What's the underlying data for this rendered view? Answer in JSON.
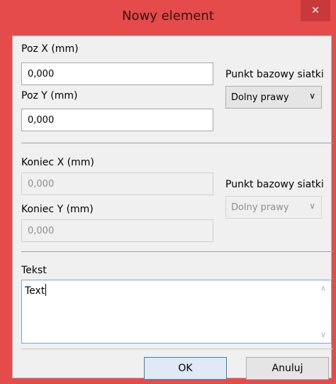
{
  "window": {
    "title": "Nowy element",
    "close_glyph": "✕",
    "close_icon": "close-icon"
  },
  "start": {
    "pos_x_label": "Poz X (mm)",
    "pos_x_value": "0,000",
    "pos_y_label": "Poz Y (mm)",
    "pos_y_value": "0,000",
    "grid_base_label": "Punkt bazowy siatki",
    "grid_base_value": "Dolny prawy"
  },
  "end": {
    "end_x_label": "Koniec X (mm)",
    "end_x_value": "0,000",
    "end_y_label": "Koniec Y (mm)",
    "end_y_value": "0,000",
    "grid_base_label": "Punkt bazowy siatki",
    "grid_base_value": "Dolny prawy"
  },
  "text": {
    "label": "Tekst",
    "value": "Text"
  },
  "buttons": {
    "ok": "OK",
    "cancel": "Anuluj"
  },
  "colors": {
    "titlebar": "#e54b4b",
    "close_button": "#c9393b",
    "dialog_bg": "#f0f0f0",
    "focus_border": "#3c7fb1"
  }
}
